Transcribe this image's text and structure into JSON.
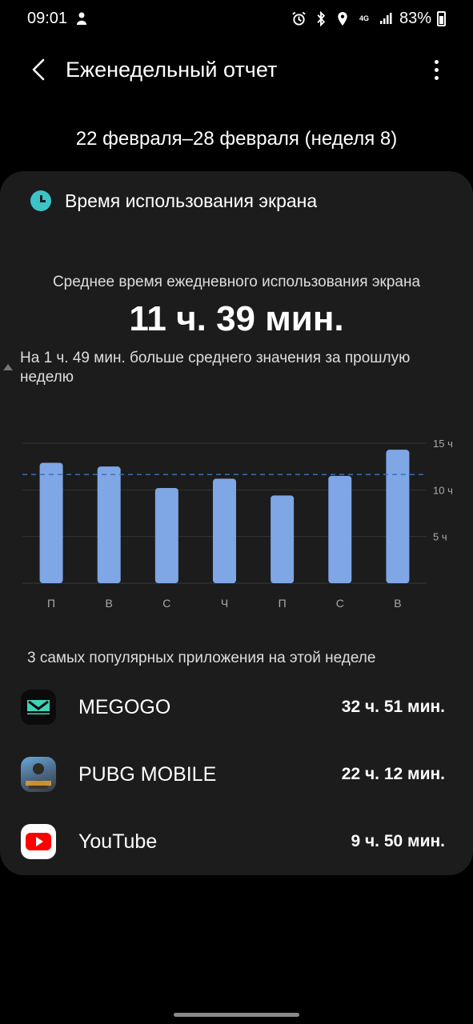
{
  "status_bar": {
    "time": "09:01",
    "network": "4G",
    "battery": "83%"
  },
  "app_bar": {
    "title": "Еженедельный отчет"
  },
  "week_range": "22 февраля–28 февраля (неделя 8)",
  "screen_time": {
    "card_title": "Время использования экрана",
    "avg_label": "Среднее время ежедневного использования экрана",
    "avg_value": "11 ч. 39 мин.",
    "comparison": "На 1 ч. 49 мин. больше среднего значения за прошлую неделю"
  },
  "chart_data": {
    "type": "bar",
    "categories": [
      "П",
      "В",
      "С",
      "Ч",
      "П",
      "С",
      "В"
    ],
    "values": [
      12.9,
      12.5,
      10.2,
      11.2,
      9.4,
      11.5,
      14.3
    ],
    "y_unit": "hours",
    "ylim": [
      0,
      15
    ],
    "yticks": [
      {
        "value": 5,
        "label": "5 ч"
      },
      {
        "value": 10,
        "label": "10 ч"
      },
      {
        "value": 15,
        "label": "15 ч"
      }
    ],
    "average_line": 11.65,
    "bar_color": "#7fa6e5",
    "average_line_color": "#3e6fb3",
    "grid": true
  },
  "top_apps": {
    "label": "3 самых популярных приложения на этой неделе",
    "apps": [
      {
        "name": "MEGOGO",
        "time": "32 ч. 51 мин.",
        "icon": "megogo-icon"
      },
      {
        "name": "PUBG MOBILE",
        "time": "22 ч. 12 мин.",
        "icon": "pubg-mobile-icon"
      },
      {
        "name": "YouTube",
        "time": "9 ч. 50 мин.",
        "icon": "youtube-icon"
      }
    ]
  }
}
